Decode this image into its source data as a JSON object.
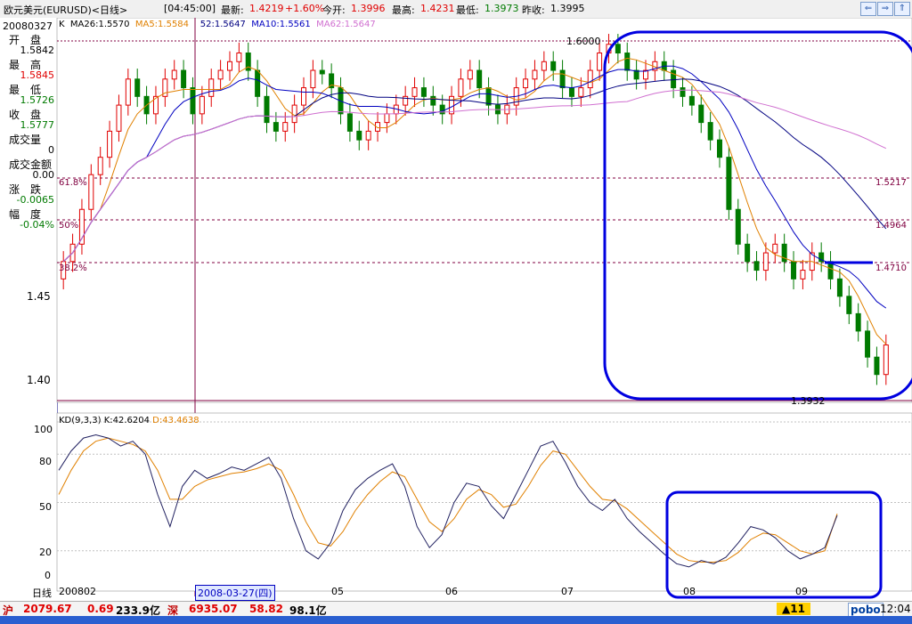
{
  "window": {
    "instrument": "欧元美元(EURUSD)<日线>",
    "time": "[04:45:00]",
    "latest_label": "最新:",
    "latest_value": "1.4219",
    "change": "+1.60%",
    "open_label": "今开:",
    "open_value": "1.3996",
    "high_label": "最高:",
    "high_value": "1.4231",
    "low_label": "最低:",
    "low_value": "1.3973",
    "prev_close_label": "昨收:",
    "prev_close_value": "1.3995",
    "nav_buttons": [
      "⇐",
      "⇒",
      "⇑"
    ]
  },
  "left_panel": {
    "date": "20080327",
    "items": [
      {
        "label": "开　盘",
        "value": "1.5842",
        "value_color": "#000000"
      },
      {
        "label": "最　高",
        "value": "1.5845",
        "value_color": "#e00000"
      },
      {
        "label": "最　低",
        "value": "1.5726",
        "value_color": "#007a00"
      },
      {
        "label": "收　盘",
        "value": "1.5777",
        "value_color": "#007a00"
      },
      {
        "label": "成交量",
        "value": "0",
        "value_color": "#000000"
      },
      {
        "label": "成交金额",
        "value": "0.00",
        "value_color": "#000000"
      },
      {
        "label": "涨　跌",
        "value": "-0.0065",
        "value_color": "#007a00"
      },
      {
        "label": "幅　度",
        "value": "-0.04%",
        "value_color": "#007a00"
      }
    ]
  },
  "price_chart": {
    "header": {
      "k_label": "K",
      "ma26": "MA26:1.5570",
      "ma5": "MA5:1.5584",
      "ma52": "52:1.5647",
      "ma10": "MA10:1.5561",
      "ma62": "MA62:1.5647"
    },
    "y_labels": [
      "1.45",
      "1.40"
    ],
    "fib_left": [
      "61.8%",
      "50%",
      "38.2%"
    ],
    "fib_right": [
      "1.5217",
      "1.4964",
      "1.4710"
    ],
    "top_marker": "1.6000",
    "bottom_marker": "1.3932"
  },
  "kd_chart": {
    "header": "KD(9,3,3)",
    "k": "K:42.6204",
    "d": "D:43.4638",
    "y_labels": [
      "100",
      "80",
      "50",
      "20",
      "0"
    ]
  },
  "x_axis": {
    "period": "日线",
    "start": "200802",
    "cursor": "2008-03-27(四)",
    "months": [
      "05",
      "06",
      "07",
      "08",
      "09"
    ]
  },
  "status_bar": {
    "sh_label": "沪",
    "sh_index": "2079.67",
    "sh_change": "0.69",
    "sh_amount": "233.9亿",
    "sz_label": "深",
    "sz_index": "6935.07",
    "sz_change": "58.82",
    "sz_amount": "98.1亿",
    "alerts": "▲11",
    "brand": "pobo",
    "clock": "12:04"
  },
  "chart_data": {
    "type": "candlestick",
    "instrument": "EURUSD",
    "x_range": [
      "2008-02",
      "2008-09"
    ],
    "y_range": [
      1.39,
      1.6
    ],
    "fib_levels": [
      {
        "label": "61.8%",
        "value": 1.5217
      },
      {
        "label": "50%",
        "value": 1.4964
      },
      {
        "label": "38.2%",
        "value": 1.471
      }
    ],
    "range_high": 1.6,
    "range_low": 1.3932,
    "close_approx": [
      1.47,
      1.48,
      1.5,
      1.52,
      1.53,
      1.545,
      1.56,
      1.575,
      1.565,
      1.555,
      1.565,
      1.575,
      1.58,
      1.57,
      1.555,
      1.565,
      1.575,
      1.58,
      1.585,
      1.59,
      1.58,
      1.565,
      1.55,
      1.545,
      1.55,
      1.56,
      1.57,
      1.58,
      1.578,
      1.57,
      1.555,
      1.545,
      1.54,
      1.545,
      1.55,
      1.555,
      1.56,
      1.565,
      1.57,
      1.565,
      1.56,
      1.555,
      1.565,
      1.575,
      1.58,
      1.57,
      1.56,
      1.555,
      1.56,
      1.57,
      1.575,
      1.58,
      1.585,
      1.58,
      1.57,
      1.565,
      1.57,
      1.58,
      1.59,
      1.595,
      1.59,
      1.58,
      1.575,
      1.58,
      1.585,
      1.58,
      1.57,
      1.565,
      1.56,
      1.55,
      1.54,
      1.53,
      1.5,
      1.48,
      1.47,
      1.465,
      1.475,
      1.48,
      1.47,
      1.46,
      1.465,
      1.475,
      1.47,
      1.46,
      1.45,
      1.44,
      1.43,
      1.415,
      1.405,
      1.422
    ],
    "kd_k_approx": [
      70,
      82,
      90,
      92,
      90,
      85,
      88,
      80,
      55,
      35,
      60,
      70,
      65,
      68,
      72,
      70,
      74,
      78,
      65,
      40,
      20,
      15,
      25,
      45,
      58,
      65,
      70,
      74,
      60,
      35,
      22,
      30,
      50,
      62,
      60,
      48,
      40,
      55,
      70,
      85,
      88,
      75,
      60,
      50,
      45,
      52,
      40,
      32,
      25,
      18,
      12,
      10,
      14,
      12,
      16,
      25,
      35,
      33,
      28,
      20,
      15,
      18,
      22,
      42
    ],
    "kd_d_approx": [
      55,
      70,
      82,
      88,
      90,
      88,
      86,
      82,
      70,
      52,
      52,
      60,
      64,
      66,
      68,
      69,
      71,
      74,
      70,
      55,
      38,
      25,
      23,
      32,
      45,
      55,
      63,
      69,
      66,
      52,
      38,
      32,
      40,
      52,
      58,
      55,
      47,
      49,
      60,
      73,
      82,
      80,
      70,
      60,
      52,
      51,
      46,
      39,
      32,
      25,
      18,
      14,
      13,
      13,
      14,
      19,
      27,
      31,
      30,
      25,
      20,
      18,
      20,
      43
    ]
  }
}
